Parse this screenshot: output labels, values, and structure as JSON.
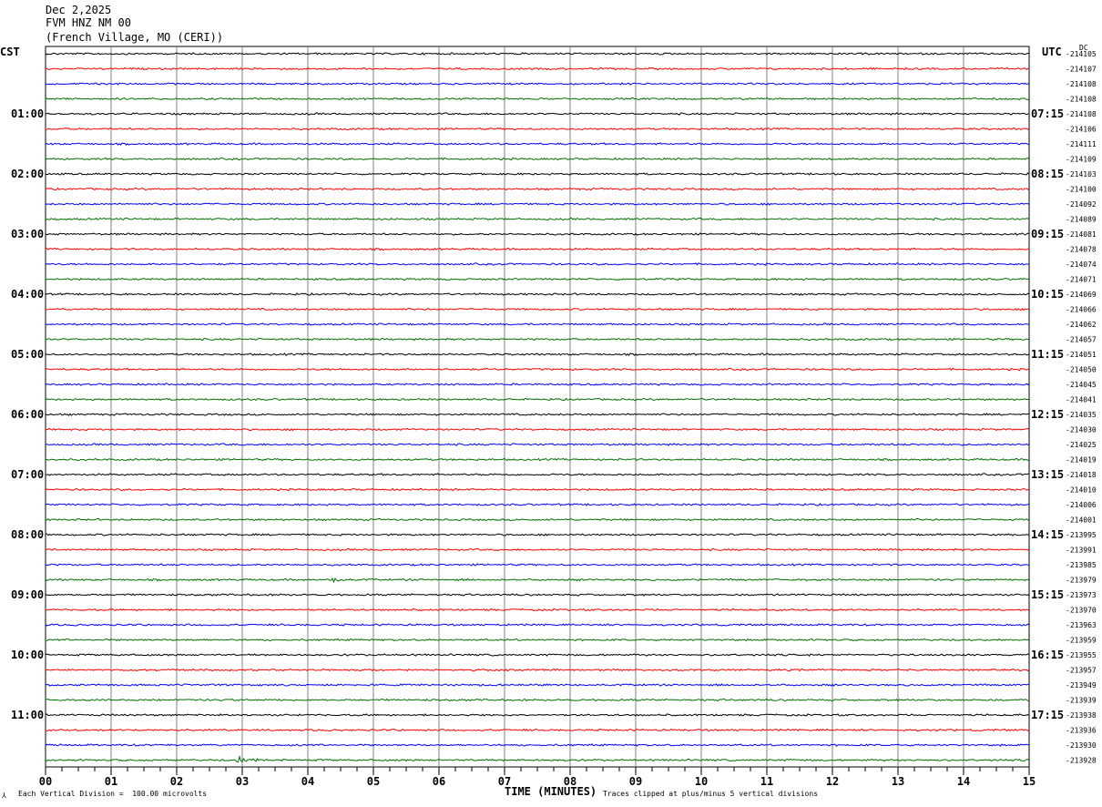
{
  "header": {
    "date": "Dec 2,2025",
    "station": "FVM HNZ NM 00",
    "location": "(French Village, MO (CERI))"
  },
  "tz_left": "CST",
  "tz_right": "UTC",
  "dc_label": "DC",
  "footer": {
    "left": "Each Vertical Division =  100.00 microvolts",
    "xaxis_title": "TIME (MINUTES)",
    "right": "Traces clipped at plus/minus 5 vertical divisions",
    "glyph": "⅄"
  },
  "colors": {
    "trace_cycle": [
      "#000000",
      "#ff0000",
      "#0000ff",
      "#007000"
    ],
    "grid": "#808080",
    "frame": "#000000"
  },
  "chart_data": {
    "type": "line",
    "x_range": [
      0,
      15
    ],
    "x_ticks": [
      "00",
      "01",
      "02",
      "03",
      "04",
      "05",
      "06",
      "07",
      "08",
      "09",
      "10",
      "11",
      "12",
      "13",
      "14",
      "15"
    ],
    "minor_ticks_per_minute": 4,
    "trace_count": 48,
    "left_labels": [
      {
        "row": 4,
        "text": "01:00"
      },
      {
        "row": 8,
        "text": "02:00"
      },
      {
        "row": 12,
        "text": "03:00"
      },
      {
        "row": 16,
        "text": "04:00"
      },
      {
        "row": 20,
        "text": "05:00"
      },
      {
        "row": 24,
        "text": "06:00"
      },
      {
        "row": 28,
        "text": "07:00"
      },
      {
        "row": 32,
        "text": "08:00"
      },
      {
        "row": 36,
        "text": "09:00"
      },
      {
        "row": 40,
        "text": "10:00"
      },
      {
        "row": 44,
        "text": "11:00"
      }
    ],
    "right_labels": [
      {
        "row": 4,
        "text": "07:15"
      },
      {
        "row": 8,
        "text": "08:15"
      },
      {
        "row": 12,
        "text": "09:15"
      },
      {
        "row": 16,
        "text": "10:15"
      },
      {
        "row": 20,
        "text": "11:15"
      },
      {
        "row": 24,
        "text": "12:15"
      },
      {
        "row": 28,
        "text": "13:15"
      },
      {
        "row": 32,
        "text": "14:15"
      },
      {
        "row": 36,
        "text": "15:15"
      },
      {
        "row": 40,
        "text": "16:15"
      },
      {
        "row": 44,
        "text": "17:15"
      }
    ],
    "dc_values": [
      "-214105",
      "-214107",
      "-214108",
      "-214108",
      "-214108",
      "-214106",
      "-214111",
      "-214109",
      "-214103",
      "-214100",
      "-214092",
      "-214089",
      "-214081",
      "-214078",
      "-214074",
      "-214071",
      "-214069",
      "-214066",
      "-214062",
      "-214057",
      "-214051",
      "-214050",
      "-214045",
      "-214041",
      "-214035",
      "-214030",
      "-214025",
      "-214019",
      "-214018",
      "-214010",
      "-214006",
      "-214001",
      "-213995",
      "-213991",
      "-213985",
      "-213979",
      "-213973",
      "-213970",
      "-213963",
      "-213959",
      "-213955",
      "-213957",
      "-213949",
      "-213939",
      "-213938",
      "-213936",
      "-213930",
      "-213928"
    ],
    "events": [
      {
        "row": 35,
        "start_min": 4.35,
        "end_min": 4.7,
        "amplitude": 3
      },
      {
        "row": 47,
        "start_min": 2.9,
        "end_min": 3.4,
        "amplitude": 5
      }
    ]
  }
}
